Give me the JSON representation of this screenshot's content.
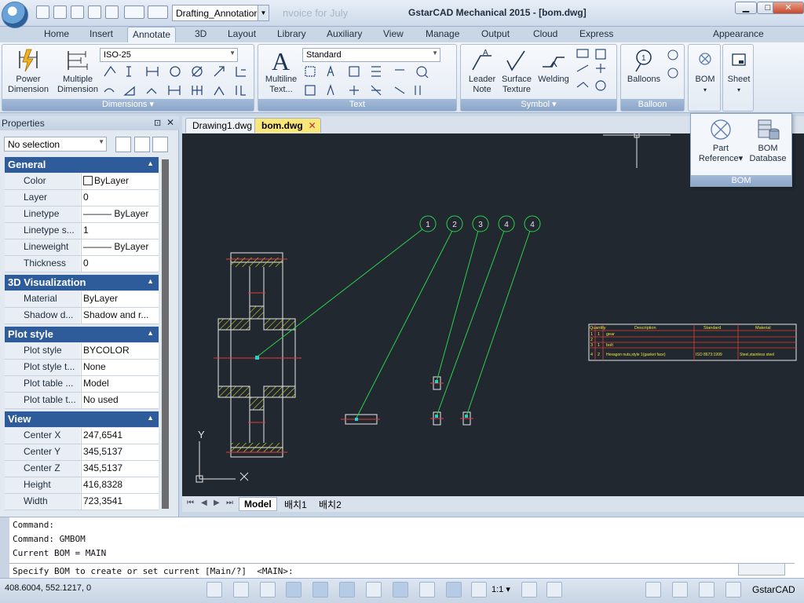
{
  "title_bar": {
    "workspace": "Drafting_Annotatior",
    "faded_text": "nvoice for July",
    "window_title": "GstarCAD Mechanical 2015 - [bom.dwg]"
  },
  "ribbon_tabs": [
    "Home",
    "Insert",
    "Annotate",
    "3D",
    "Layout",
    "Library",
    "Auxiliary",
    "View",
    "Manage",
    "Output",
    "Cloud",
    "Express"
  ],
  "active_tab": "Annotate",
  "appearance_label": "Appearance",
  "ribbon": {
    "dimensions": {
      "style": "ISO-25",
      "power_dimension": [
        "Power",
        "Dimension"
      ],
      "multiple_dimension": [
        "Multiple",
        "Dimension"
      ],
      "title": "Dimensions"
    },
    "text": {
      "style": "Standard",
      "multiline": [
        "Multiline",
        "Text..."
      ],
      "title": "Text"
    },
    "symbol": {
      "leader_note": [
        "Leader",
        "Note"
      ],
      "surface_texture": [
        "Surface",
        "Texture"
      ],
      "welding": "Welding",
      "title": "Symbol"
    },
    "balloon": {
      "balloons": "Balloons",
      "title": "Balloon"
    },
    "bom": {
      "label": "BOM"
    },
    "sheet": {
      "label": "Sheet"
    }
  },
  "bom_popup": {
    "part_reference": [
      "Part",
      "Reference"
    ],
    "bom_database": [
      "BOM",
      "Database"
    ],
    "title": "BOM"
  },
  "properties": {
    "title": "Properties",
    "selection": "No selection",
    "sections": [
      {
        "name": "General",
        "rows": [
          {
            "k": "Color",
            "v": "ByLayer"
          },
          {
            "k": "Layer",
            "v": "0"
          },
          {
            "k": "Linetype",
            "v": "——— ByLayer"
          },
          {
            "k": "Linetype s...",
            "v": "1"
          },
          {
            "k": "Lineweight",
            "v": "——— ByLayer"
          },
          {
            "k": "Thickness",
            "v": "0"
          }
        ]
      },
      {
        "name": "3D Visualization",
        "rows": [
          {
            "k": "Material",
            "v": "ByLayer"
          },
          {
            "k": "Shadow d...",
            "v": "Shadow and r..."
          }
        ]
      },
      {
        "name": "Plot style",
        "rows": [
          {
            "k": "Plot style",
            "v": "BYCOLOR"
          },
          {
            "k": "Plot style t...",
            "v": "None"
          },
          {
            "k": "Plot table ...",
            "v": "Model"
          },
          {
            "k": "Plot table t...",
            "v": "No used"
          }
        ]
      },
      {
        "name": "View",
        "rows": [
          {
            "k": "Center X",
            "v": "247,6541"
          },
          {
            "k": "Center Y",
            "v": "345,5137"
          },
          {
            "k": "Center Z",
            "v": "345,5137"
          },
          {
            "k": "Height",
            "v": "416,8328"
          },
          {
            "k": "Width",
            "v": "723,3541"
          }
        ]
      }
    ]
  },
  "doc_tabs": [
    "Drawing1.dwg",
    "bom.dwg"
  ],
  "active_doc": "bom.dwg",
  "layout_tabs": [
    "Model",
    "배치1",
    "배치2"
  ],
  "balloons": [
    "1",
    "2",
    "3",
    "4",
    "4"
  ],
  "bom_table": {
    "headers": [
      "Quantity",
      "Description",
      "Standard",
      "Material"
    ],
    "rows": [
      [
        "1",
        "1",
        "gear",
        "",
        ""
      ],
      [
        "2",
        "",
        "",
        "",
        ""
      ],
      [
        "3",
        "1",
        "bolt",
        "",
        ""
      ],
      [
        "4",
        "2",
        "Hexagon nuts,style 1(gasket face)",
        "ISO 8673:1999",
        "Steel,stainless steel"
      ]
    ]
  },
  "ucs": {
    "x": "X",
    "y": "Y"
  },
  "command": {
    "lines": [
      "Command:",
      "Command: GMBOM",
      "Current BOM = MAIN"
    ],
    "prompt": "Specify BOM to create or set current [Main/?]  <MAIN>:"
  },
  "status": {
    "coords": "408.6004, 552.1217, 0",
    "scale": "1:1",
    "app": "GstarCAD"
  }
}
